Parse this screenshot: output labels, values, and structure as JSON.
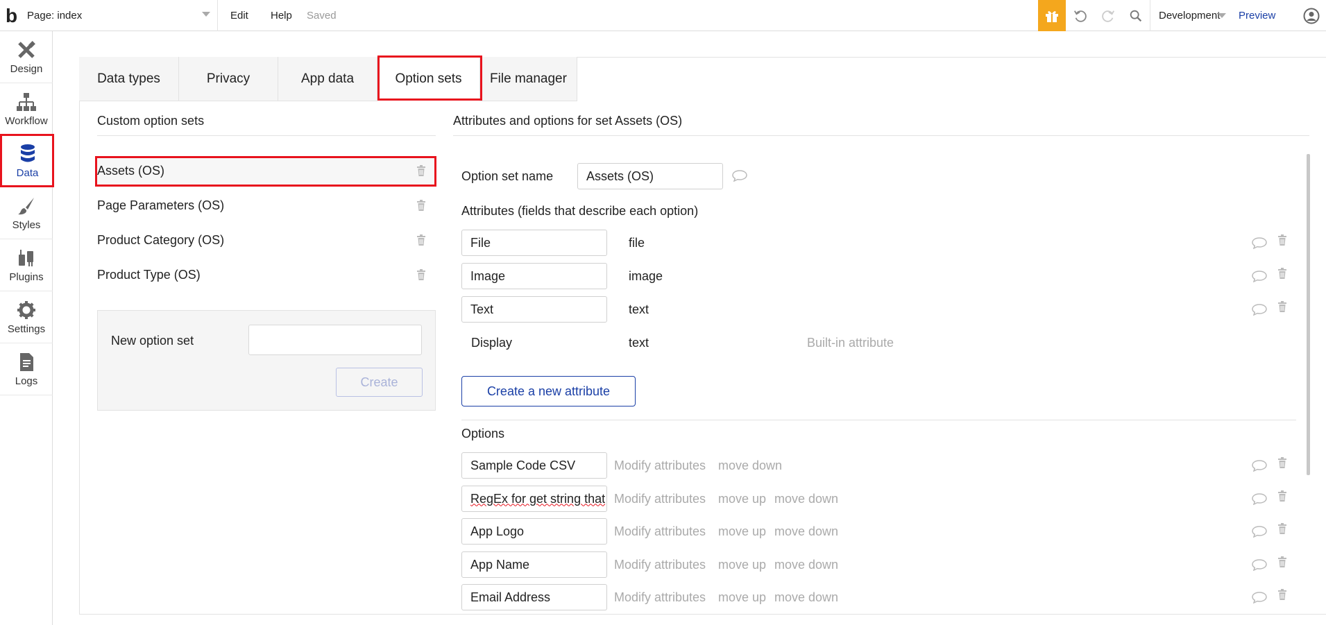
{
  "topbar": {
    "logo": "b",
    "page_label": "Page: index",
    "menu": [
      "Edit",
      "Help"
    ],
    "status": "Saved",
    "environment": "Development",
    "preview": "Preview",
    "colors": {
      "gift_bg": "#f4a71d",
      "accent": "#1a3fa6"
    }
  },
  "leftnav": [
    {
      "label": "Design",
      "icon": "design-icon"
    },
    {
      "label": "Workflow",
      "icon": "workflow-icon"
    },
    {
      "label": "Data",
      "icon": "database-icon",
      "active": true
    },
    {
      "label": "Styles",
      "icon": "brush-icon"
    },
    {
      "label": "Plugins",
      "icon": "plug-icon"
    },
    {
      "label": "Settings",
      "icon": "gear-icon"
    },
    {
      "label": "Logs",
      "icon": "document-icon"
    }
  ],
  "tabs": [
    "Data types",
    "Privacy",
    "App data",
    "Option sets",
    "File manager"
  ],
  "active_tab": "Option sets",
  "left_panel": {
    "title": "Custom option sets",
    "items": [
      "Assets (OS)",
      "Page Parameters (OS)",
      "Product Category (OS)",
      "Product Type (OS)"
    ],
    "selected": "Assets (OS)",
    "new_label": "New option set",
    "new_value": "",
    "create_label": "Create"
  },
  "right_panel": {
    "title": "Attributes and options for set Assets (OS)",
    "name_label": "Option set name",
    "name_value": "Assets (OS)",
    "attributes_label": "Attributes (fields that describe each option)",
    "attributes": [
      {
        "name": "File",
        "type": "file"
      },
      {
        "name": "Image",
        "type": "image"
      },
      {
        "name": "Text",
        "type": "text"
      }
    ],
    "builtin": {
      "name": "Display",
      "type": "text",
      "note": "Built-in attribute"
    },
    "create_attr_label": "Create a new attribute",
    "options_label": "Options",
    "options": [
      {
        "value": "Sample Code CSV",
        "actions": [
          "Modify attributes",
          "move down"
        ]
      },
      {
        "value": "RegEx for get string that",
        "actions": [
          "Modify attributes",
          "move up",
          "move down"
        ]
      },
      {
        "value": "App Logo",
        "actions": [
          "Modify attributes",
          "move up",
          "move down"
        ]
      },
      {
        "value": "App Name",
        "actions": [
          "Modify attributes",
          "move up",
          "move down"
        ]
      },
      {
        "value": "Email Address",
        "actions": [
          "Modify attributes",
          "move up",
          "move down"
        ]
      }
    ]
  }
}
